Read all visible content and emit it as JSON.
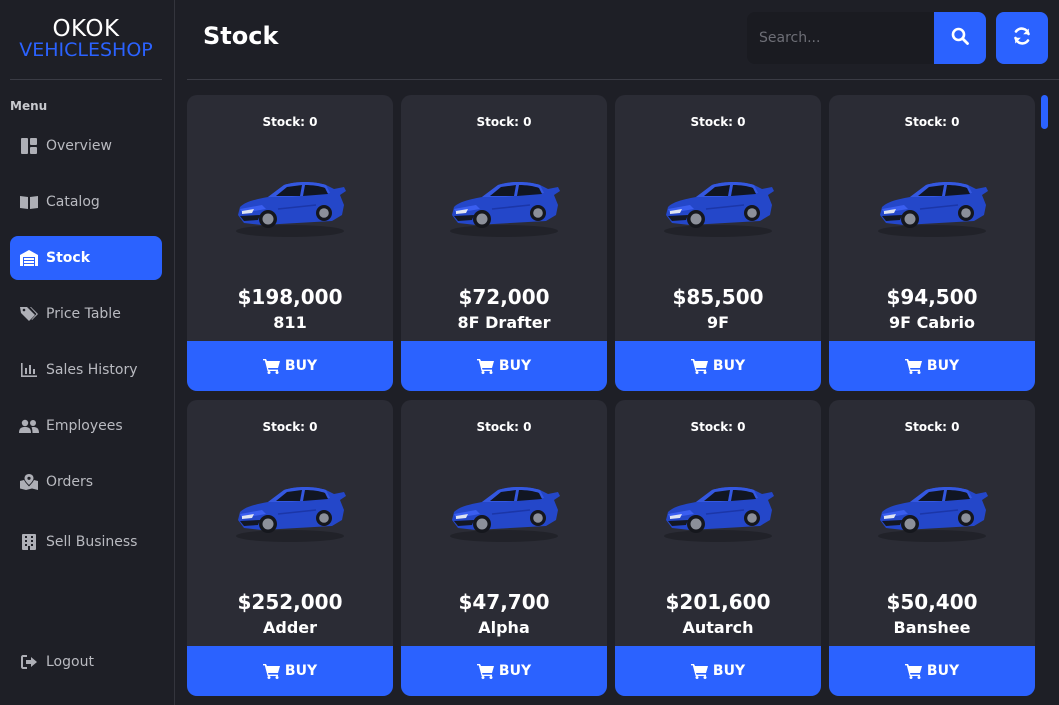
{
  "brand": {
    "line1": "OKOK",
    "line2": "VEHICLESHOP"
  },
  "menu_title": "Menu",
  "nav": [
    {
      "label": "Overview",
      "icon": "dashboard-icon"
    },
    {
      "label": "Catalog",
      "icon": "book-icon"
    },
    {
      "label": "Stock",
      "icon": "warehouse-icon",
      "active": true
    },
    {
      "label": "Price Table",
      "icon": "tags-icon"
    },
    {
      "label": "Sales History",
      "icon": "chart-bar-icon"
    },
    {
      "label": "Employees",
      "icon": "users-icon"
    },
    {
      "label": "Orders",
      "icon": "map-marked-icon"
    },
    {
      "label": "Sell Business",
      "icon": "building-icon"
    },
    {
      "label": "Logout",
      "icon": "sign-out-icon"
    }
  ],
  "header": {
    "title": "Stock"
  },
  "search": {
    "placeholder": "Search..."
  },
  "vehicles": [
    {
      "stock": "Stock: 0",
      "price": "$198,000",
      "name": "811"
    },
    {
      "stock": "Stock: 0",
      "price": "$72,000",
      "name": "8F Drafter"
    },
    {
      "stock": "Stock: 0",
      "price": "$85,500",
      "name": "9F"
    },
    {
      "stock": "Stock: 0",
      "price": "$94,500",
      "name": "9F Cabrio"
    },
    {
      "stock": "Stock: 0",
      "price": "$252,000",
      "name": "Adder"
    },
    {
      "stock": "Stock: 0",
      "price": "$47,700",
      "name": "Alpha"
    },
    {
      "stock": "Stock: 0",
      "price": "$201,600",
      "name": "Autarch"
    },
    {
      "stock": "Stock: 0",
      "price": "$50,400",
      "name": "Banshee"
    }
  ],
  "buy_label": "BUY",
  "colors": {
    "accent": "#2b62ff",
    "card": "#2b2c35",
    "background": "#1e1f26"
  }
}
